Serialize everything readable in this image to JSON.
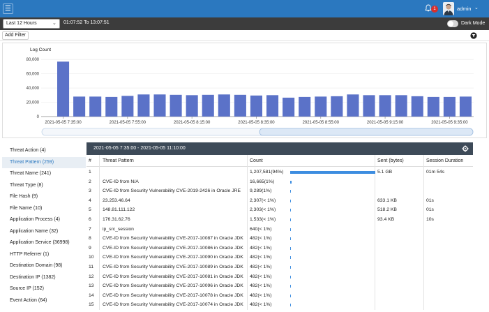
{
  "header": {
    "menu_icon": "hamburger-icon",
    "notifications_count": "1",
    "user_name": "admin",
    "accent": "#2b78bf"
  },
  "timebar": {
    "range_select": "Last 12 Hours",
    "time_range": "01:07:52 To 13:07:51",
    "dark_mode_label": "Dark Mode",
    "dark_mode_on": false
  },
  "filterbar": {
    "add_filter_label": "Add Filter"
  },
  "chart_data": {
    "type": "bar",
    "ylabel": "Log Count",
    "ylim": [
      0,
      90000
    ],
    "yticks": [
      "0",
      "20,000",
      "40,000",
      "60,000",
      "80,000"
    ],
    "xtick_labels": [
      "2021-05-05 7:35:00",
      "2021-05-05 7:55:00",
      "2021-05-05 8:15:00",
      "2021-05-05 8:35:00",
      "2021-05-05 8:55:00",
      "2021-05-05 9:15:00",
      "2021-05-05 9:35:00"
    ],
    "values": [
      77000,
      28000,
      28000,
      27500,
      29000,
      31000,
      31000,
      30500,
      30000,
      30500,
      31000,
      30500,
      29500,
      30000,
      26500,
      27500,
      28000,
      28500,
      31000,
      30000,
      30000,
      30000,
      28500,
      27500,
      27500,
      28000
    ],
    "bar_color": "#5b72c8"
  },
  "sidebar": {
    "items": [
      {
        "label": "Threat Action (4)"
      },
      {
        "label": "Threat Pattern (259)"
      },
      {
        "label": "Threat Name (241)"
      },
      {
        "label": "Threat Type (8)"
      },
      {
        "label": "File Hash (9)"
      },
      {
        "label": "File Name (10)"
      },
      {
        "label": "Application Process (4)"
      },
      {
        "label": "Application Name (32)"
      },
      {
        "label": "Application Service (36998)"
      },
      {
        "label": "HTTP Referrer (1)"
      },
      {
        "label": "Destination Domain (98)"
      },
      {
        "label": "Destination IP (1382)"
      },
      {
        "label": "Source IP (152)"
      },
      {
        "label": "Event Action (64)"
      }
    ],
    "active_index": 1
  },
  "table": {
    "title": "2021-05-05 7:35:00 - 2021-05-05 11:10:00",
    "columns": [
      "#",
      "Threat Pattern",
      "Count",
      "Sent (bytes)",
      "Session Duration"
    ],
    "rows": [
      {
        "n": "1",
        "pattern": "",
        "count": "1,207,581(94%)",
        "share": 0.94,
        "sent": "5.1 GB",
        "duration": "01m 54s"
      },
      {
        "n": "2",
        "pattern": "CVE-ID from N/A",
        "count": "16,665(1%)",
        "share": 0.013,
        "sent": "",
        "duration": ""
      },
      {
        "n": "3",
        "pattern": "CVE-ID from Security Vulnerability CVE-2019-2426 in Oracle JRE",
        "count": "9,289(1%)",
        "share": 0.008,
        "sent": "",
        "duration": ""
      },
      {
        "n": "4",
        "pattern": "23.253.46.64",
        "count": "2,307(< 1%)",
        "share": 0.002,
        "sent": "633.1 KB",
        "duration": "01s"
      },
      {
        "n": "5",
        "pattern": "148.81.111.122",
        "count": "2,303(< 1%)",
        "share": 0.002,
        "sent": "518.2 KB",
        "duration": "01s"
      },
      {
        "n": "6",
        "pattern": "176.31.62.76",
        "count": "1,533(< 1%)",
        "share": 0.001,
        "sent": "93.4 KB",
        "duration": "10s"
      },
      {
        "n": "7",
        "pattern": "ip_src_session",
        "count": "640(< 1%)",
        "share": 0.0005,
        "sent": "",
        "duration": ""
      },
      {
        "n": "8",
        "pattern": "CVE-ID from Security Vulnerability CVE-2017-10087 in Oracle JDK",
        "count": "482(< 1%)",
        "share": 0.0004,
        "sent": "",
        "duration": ""
      },
      {
        "n": "9",
        "pattern": "CVE-ID from Security Vulnerability CVE-2017-10086 in Oracle JDK",
        "count": "482(< 1%)",
        "share": 0.0004,
        "sent": "",
        "duration": ""
      },
      {
        "n": "10",
        "pattern": "CVE-ID from Security Vulnerability CVE-2017-10090 in Oracle JDK",
        "count": "482(< 1%)",
        "share": 0.0004,
        "sent": "",
        "duration": ""
      },
      {
        "n": "11",
        "pattern": "CVE-ID from Security Vulnerability CVE-2017-10089 in Oracle JDK",
        "count": "482(< 1%)",
        "share": 0.0004,
        "sent": "",
        "duration": ""
      },
      {
        "n": "12",
        "pattern": "CVE-ID from Security Vulnerability CVE-2017-10081 in Oracle JDK",
        "count": "482(< 1%)",
        "share": 0.0004,
        "sent": "",
        "duration": ""
      },
      {
        "n": "13",
        "pattern": "CVE-ID from Security Vulnerability CVE-2017-10096 in Oracle JDK",
        "count": "482(< 1%)",
        "share": 0.0004,
        "sent": "",
        "duration": ""
      },
      {
        "n": "14",
        "pattern": "CVE-ID from Security Vulnerability CVE-2017-10078 in Oracle JDK",
        "count": "482(< 1%)",
        "share": 0.0004,
        "sent": "",
        "duration": ""
      },
      {
        "n": "15",
        "pattern": "CVE-ID from Security Vulnerability CVE-2017-10074 in Oracle JDK",
        "count": "482(< 1%)",
        "share": 0.0004,
        "sent": "",
        "duration": ""
      }
    ]
  }
}
